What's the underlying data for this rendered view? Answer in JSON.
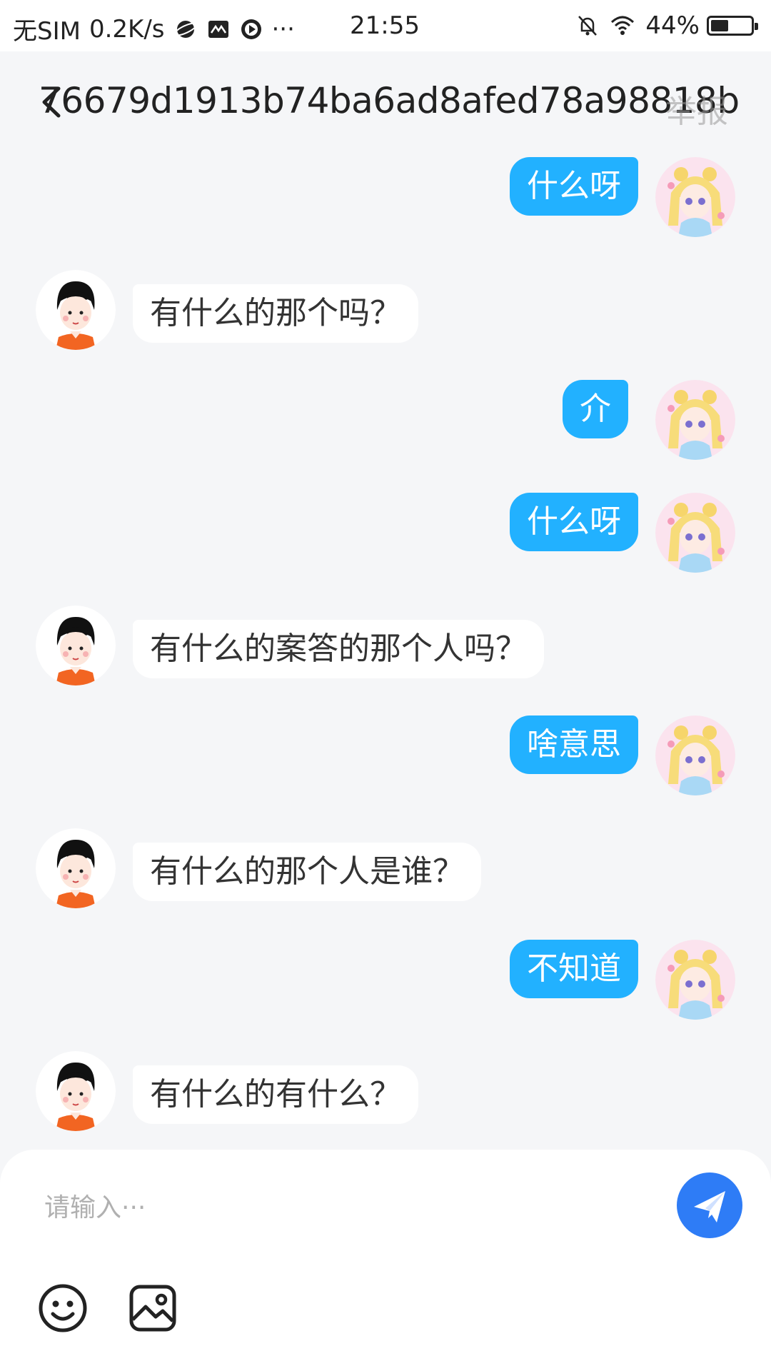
{
  "status_bar": {
    "carrier": "无SIM",
    "speed": "0.2K/s",
    "dots": "···",
    "time": "21:55",
    "battery": "44%",
    "battery_level": 0.44
  },
  "header": {
    "title": "76679d1913b74ba6ad8afed78a98818b",
    "report": "举报"
  },
  "messages": [
    {
      "side": "me",
      "text": "什么呀"
    },
    {
      "side": "other",
      "text": "有什么的那个吗？"
    },
    {
      "side": "me",
      "text": "介"
    },
    {
      "side": "me",
      "text": "什么呀"
    },
    {
      "side": "other",
      "text": "有什么的案答的那个人吗？"
    },
    {
      "side": "me",
      "text": "啥意思"
    },
    {
      "side": "other",
      "text": "有什么的那个人是谁？"
    },
    {
      "side": "me",
      "text": "不知道"
    },
    {
      "side": "other",
      "text": "有什么的有什么？"
    }
  ],
  "composer": {
    "placeholder": "请输入···"
  },
  "icons": {
    "send": "paper-plane-icon",
    "emoji": "smiley-icon",
    "image": "image-icon"
  },
  "colors": {
    "my_bubble": "#22b1ff",
    "other_bubble": "#ffffff",
    "send_button": "#2e7cf6",
    "background": "#f5f6f8"
  }
}
